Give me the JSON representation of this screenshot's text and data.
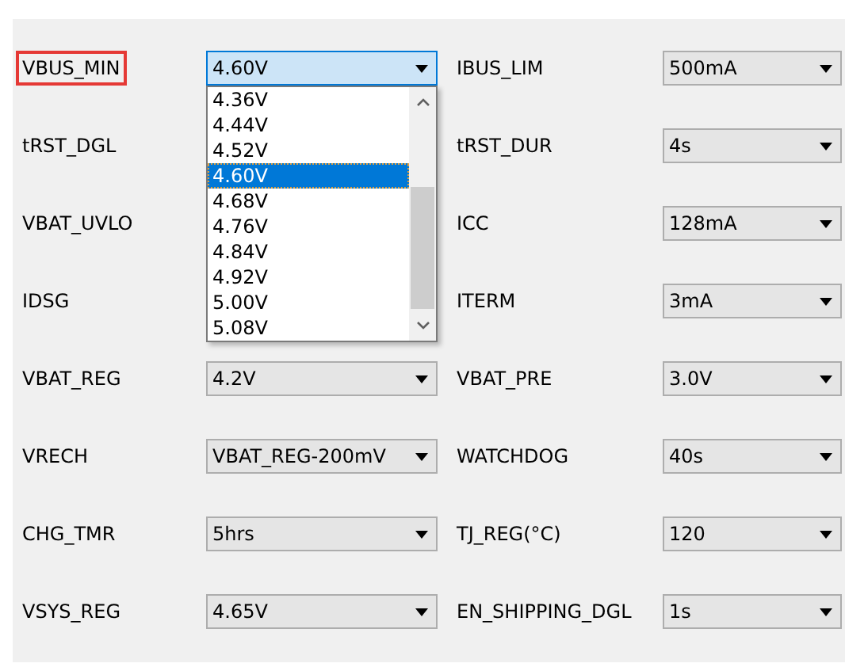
{
  "rows": [
    {
      "left": {
        "label": "VBUS_MIN",
        "highlighted": true,
        "value": "4.60V",
        "expanded": true,
        "options": [
          {
            "text": "4.36V",
            "selected": false
          },
          {
            "text": "4.44V",
            "selected": false
          },
          {
            "text": "4.52V",
            "selected": false
          },
          {
            "text": "4.60V",
            "selected": true
          },
          {
            "text": "4.68V",
            "selected": false
          },
          {
            "text": "4.76V",
            "selected": false
          },
          {
            "text": "4.84V",
            "selected": false
          },
          {
            "text": "4.92V",
            "selected": false
          },
          {
            "text": "5.00V",
            "selected": false
          },
          {
            "text": "5.08V",
            "selected": false
          }
        ]
      },
      "right": {
        "label": "IBUS_LIM",
        "highlighted": false,
        "value": "500mA",
        "expanded": false
      }
    },
    {
      "left": {
        "label": "tRST_DGL",
        "highlighted": false
      },
      "right": {
        "label": "tRST_DUR",
        "highlighted": false,
        "value": "4s",
        "expanded": false
      }
    },
    {
      "left": {
        "label": "VBAT_UVLO",
        "highlighted": false
      },
      "right": {
        "label": "ICC",
        "highlighted": false,
        "value": "128mA",
        "expanded": false
      }
    },
    {
      "left": {
        "label": "IDSG",
        "highlighted": false
      },
      "right": {
        "label": "ITERM",
        "highlighted": false,
        "value": "3mA",
        "expanded": false
      }
    },
    {
      "left": {
        "label": "VBAT_REG",
        "highlighted": false,
        "value": "4.2V",
        "expanded": false
      },
      "right": {
        "label": "VBAT_PRE",
        "highlighted": false,
        "value": "3.0V",
        "expanded": false
      }
    },
    {
      "left": {
        "label": "VRECH",
        "highlighted": false,
        "value": "VBAT_REG-200mV",
        "expanded": false
      },
      "right": {
        "label": "WATCHDOG",
        "highlighted": false,
        "value": "40s",
        "expanded": false
      }
    },
    {
      "left": {
        "label": "CHG_TMR",
        "highlighted": false,
        "value": "5hrs",
        "expanded": false
      },
      "right": {
        "label": "TJ_REG(°C)",
        "highlighted": false,
        "value": "120",
        "expanded": false
      }
    },
    {
      "left": {
        "label": "VSYS_REG",
        "highlighted": false,
        "value": "4.65V",
        "expanded": false
      },
      "right": {
        "label": "EN_SHIPPING_DGL",
        "highlighted": false,
        "value": "1s",
        "expanded": false
      }
    }
  ]
}
